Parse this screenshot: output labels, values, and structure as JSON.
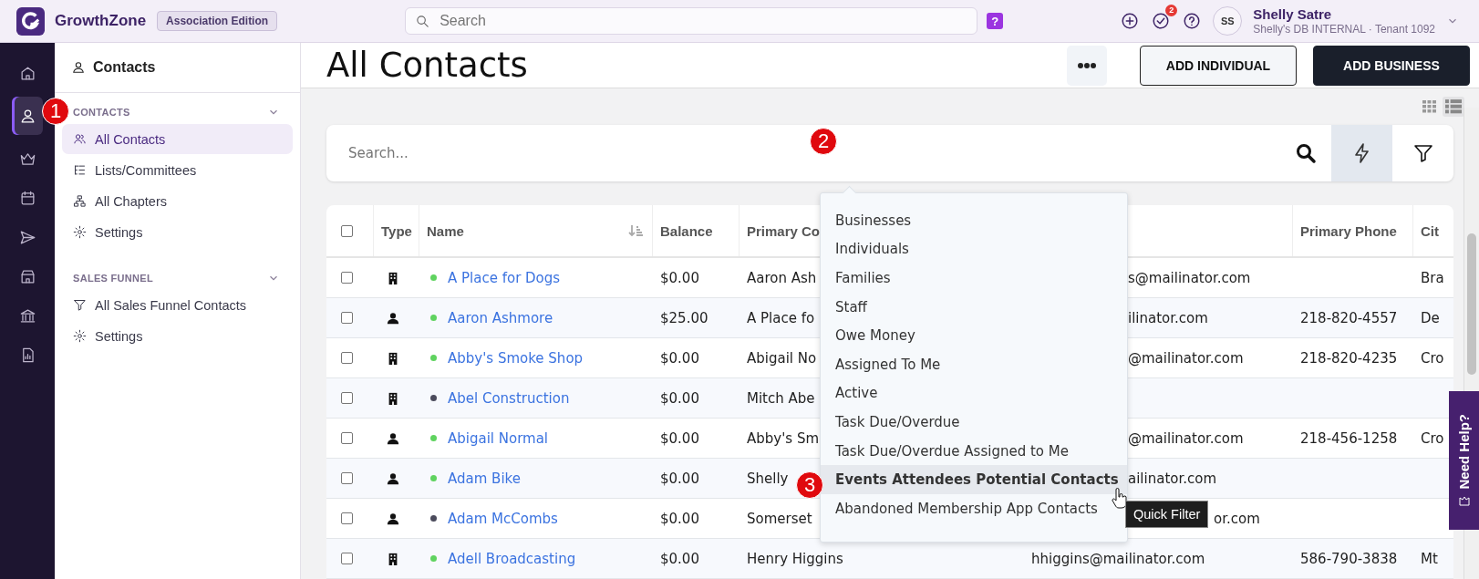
{
  "topbar": {
    "brand": "GrowthZone",
    "edition": "Association Edition",
    "search": {
      "placeholder": "Search"
    },
    "help_badge": "?",
    "tasks_count": "2",
    "avatar": "SS",
    "user_name": "Shelly Satre",
    "user_org": "Shelly's DB INTERNAL · Tenant 1092"
  },
  "rail": [
    {
      "selected": false
    },
    {
      "selected": true
    },
    {
      "selected": false
    },
    {
      "selected": false
    },
    {
      "selected": false
    },
    {
      "selected": false
    },
    {
      "selected": false
    },
    {
      "selected": false
    }
  ],
  "sidebar": {
    "title": "Contacts",
    "sections": [
      {
        "label": "CONTACTS",
        "expanded": true,
        "items": [
          {
            "label": "All Contacts",
            "selected": true
          },
          {
            "label": "Lists/Committees",
            "selected": false
          },
          {
            "label": "All Chapters",
            "selected": false
          },
          {
            "label": "Settings",
            "selected": false
          }
        ]
      },
      {
        "label": "SALES FUNNEL",
        "expanded": true,
        "items": [
          {
            "label": "All Sales Funnel Contacts",
            "selected": false
          },
          {
            "label": "Settings",
            "selected": false
          }
        ]
      }
    ]
  },
  "page": {
    "title": "All Contacts",
    "buttons": [
      {
        "kind": "more"
      },
      {
        "kind": "outline",
        "label": "ADD INDIVIDUAL"
      },
      {
        "kind": "dark",
        "label": "ADD BUSINESS"
      }
    ],
    "search": {
      "placeholder": "Search..."
    },
    "quick_filter_menu": {
      "items": [
        {
          "label": "Businesses",
          "selected": false
        },
        {
          "label": "Individuals",
          "selected": false
        },
        {
          "label": "Families",
          "selected": false
        },
        {
          "label": "Staff",
          "selected": false
        },
        {
          "label": "Owe Money",
          "selected": false
        },
        {
          "label": "Assigned To Me",
          "selected": false
        },
        {
          "label": "Active",
          "selected": false
        },
        {
          "label": "Task Due/Overdue",
          "selected": false
        },
        {
          "label": "Task Due/Overdue Assigned to Me",
          "selected": false
        },
        {
          "label": "Events Attendees Potential Contacts",
          "selected": true
        },
        {
          "label": "Abandoned Membership App Contacts",
          "selected": false
        }
      ]
    },
    "tooltip": "Quick Filter",
    "table": {
      "header": {
        "checked": false,
        "type": "Type",
        "name": "Name",
        "balance": "Balance",
        "primary_contact": "Primary Co",
        "primary_phone": "Primary Phone",
        "city": "Cit"
      },
      "rows": [
        {
          "checked": false,
          "kind": "business",
          "color": "#5fd35f",
          "name": "A Place for Dogs",
          "balance": "$0.00",
          "contact": "Aaron Ash",
          "email": {
            "kind": "menu",
            "text": "s@mailinator.com"
          },
          "phone": "",
          "city": "Bra"
        },
        {
          "checked": false,
          "kind": "individual",
          "color": "#5fd35f",
          "name": "Aaron Ashmore",
          "balance": "$25.00",
          "contact": "A Place fo",
          "email": {
            "kind": "menu",
            "text": "ilinator.com"
          },
          "phone": "218-820-4557",
          "city": "De"
        },
        {
          "checked": false,
          "kind": "business",
          "color": "#5fd35f",
          "name": "Abby's Smoke Shop",
          "balance": "$0.00",
          "contact": "Abigail No",
          "email": {
            "kind": "menu",
            "text": "@mailinator.com"
          },
          "phone": "218-820-4235",
          "city": "Cro"
        },
        {
          "checked": false,
          "kind": "business",
          "color": "#4b4b5c",
          "name": "Abel Construction",
          "balance": "$0.00",
          "contact": "Mitch Abe",
          "phone": "",
          "city": ""
        },
        {
          "checked": false,
          "kind": "individual",
          "color": "#5fd35f",
          "name": "Abigail Normal",
          "balance": "$0.00",
          "contact": "Abby's Sm",
          "email": {
            "kind": "menu",
            "text": "@mailinator.com"
          },
          "phone": "218-456-1258",
          "city": "Cro"
        },
        {
          "checked": false,
          "kind": "individual",
          "color": "#5fd35f",
          "name": "Adam Bike",
          "balance": "$0.00",
          "contact": "Shelly",
          "email": {
            "kind": "menu",
            "text": "ailinator.com"
          },
          "phone": "",
          "city": ""
        },
        {
          "checked": false,
          "kind": "individual",
          "color": "#4b4b5c",
          "name": "Adam McCombs",
          "balance": "$0.00",
          "contact": "Somerset",
          "email": {
            "kind": "tooltip",
            "text": "or.com"
          },
          "phone": "",
          "city": ""
        },
        {
          "checked": false,
          "kind": "business",
          "color": "#5fd35f",
          "name": "Adell Broadcasting",
          "balance": "$0.00",
          "contact": "Henry Higgins",
          "email": {
            "kind": "plain",
            "text": "hhiggins@mailinator.com"
          },
          "phone": "586-790-3838",
          "city": "Mt"
        }
      ]
    }
  },
  "need_help": "Need Help?",
  "step_markers": [
    "1",
    "2",
    "3"
  ]
}
